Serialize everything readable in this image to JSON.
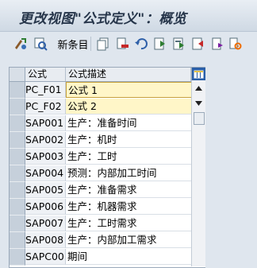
{
  "window": {
    "title": "更改视图\"公式定义\"：概览"
  },
  "toolbar": {
    "new_entries_label": "新条目",
    "icons": [
      "display-change-icon",
      "where-used-icon",
      "new-entries",
      "copy-icon",
      "delete-icon",
      "undo-icon",
      "select-all-icon",
      "select-block-icon",
      "deselect-all-icon",
      "print-icon",
      "configure-icon"
    ]
  },
  "table": {
    "columns": [
      "公式",
      "公式描述"
    ],
    "rows": [
      {
        "code": "PC_F01",
        "desc": "公式 1"
      },
      {
        "code": "PC_F02",
        "desc": "公式 2"
      },
      {
        "code": "SAP001",
        "desc": "生产：准备时间"
      },
      {
        "code": "SAP002",
        "desc": "生产：机时"
      },
      {
        "code": "SAP003",
        "desc": "生产：工时"
      },
      {
        "code": "SAP004",
        "desc": "预测：内部加工时间"
      },
      {
        "code": "SAP005",
        "desc": "生产：准备需求"
      },
      {
        "code": "SAP006",
        "desc": "生产：机器需求"
      },
      {
        "code": "SAP007",
        "desc": "生产：工时需求"
      },
      {
        "code": "SAP008",
        "desc": "生产：内部加工需求"
      },
      {
        "code": "SAPC00",
        "desc": "期间"
      }
    ]
  },
  "colors": {
    "header_accent": "#2a5fa8",
    "edit_field": "#fff6c8",
    "title": "#26354a"
  }
}
